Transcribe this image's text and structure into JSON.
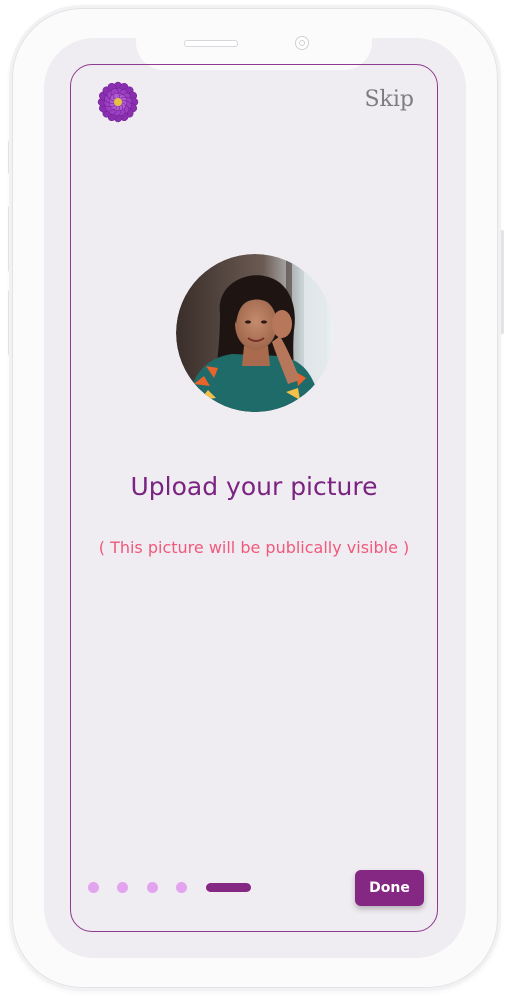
{
  "header": {
    "skip_label": "Skip"
  },
  "onboarding": {
    "title": "Upload your picture",
    "subtitle": "( This picture will be publically visible )",
    "total_steps": 5,
    "current_step": 5
  },
  "footer": {
    "done_label": "Done"
  },
  "icons": {
    "logo": "purple-flower-icon",
    "avatar": "profile-photo"
  },
  "colors": {
    "accent": "#852883",
    "title": "#7a2380",
    "subtitle": "#f0587c",
    "inactive_dot": "#e3a4ef",
    "screen_bg": "#f0edf2"
  }
}
